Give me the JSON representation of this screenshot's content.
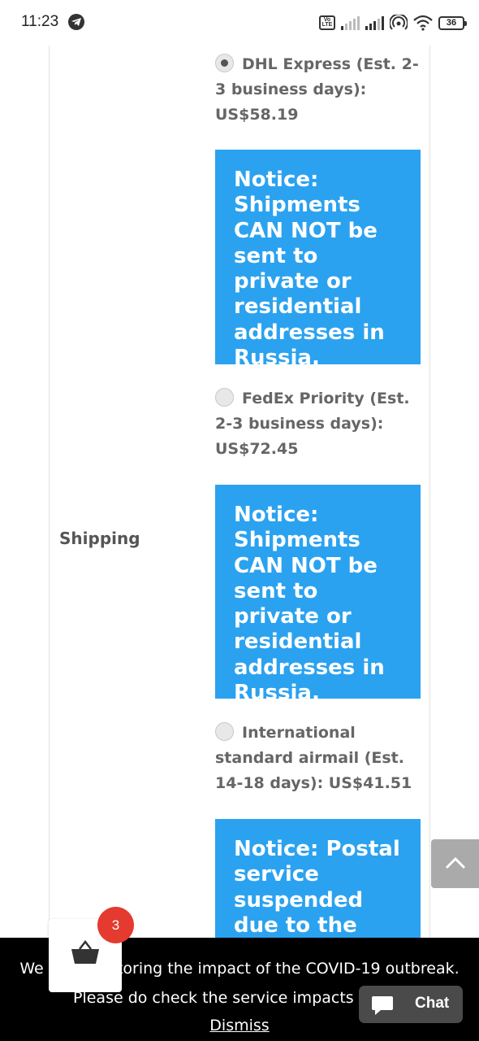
{
  "status_bar": {
    "time": "11:23",
    "battery": "36",
    "volte_label": "Vo LTE"
  },
  "form": {
    "shipping_label": "Shipping",
    "options": [
      {
        "label": "DHL Express (Est. 2-3 business days): US$58.19",
        "selected": true,
        "notice": "Notice: Shipments CAN NOT be sent to private or residential addresses in Russia."
      },
      {
        "label": "FedEx Priority (Est. 2-3 business days): US$72.45",
        "selected": false,
        "notice": "Notice: Shipments CAN NOT be sent to private or residential addresses in Russia."
      },
      {
        "label": "International standard airmail (Est. 14-18 days): US$41.51",
        "selected": false,
        "notice": "Notice: Postal service suspended due to the"
      }
    ]
  },
  "banner": {
    "line1": "We are monitoring the impact of the COVID-19 outbreak.",
    "line2": "Please do check the service impacts",
    "dismiss": "Dismiss"
  },
  "cart": {
    "count": "3"
  },
  "chat": {
    "label": "Chat"
  },
  "colors": {
    "notice_bg": "#2ba2f0",
    "badge": "#e53a2f",
    "banner_bg": "#000000"
  }
}
